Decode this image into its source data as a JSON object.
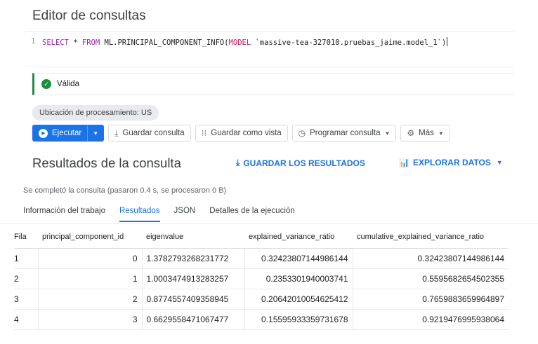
{
  "editor": {
    "title": "Editor de consultas",
    "line_number": "1",
    "code": {
      "kw1": "SELECT",
      "star": " * ",
      "kw2": "FROM",
      "fn": " ML.PRINCIPAL_COMPONENT_INFO",
      "open": "(",
      "kw3": "MODEL",
      "str": " `massive-tea-327010.pruebas_jaime.model_1`",
      "close": ")"
    }
  },
  "validation": {
    "status": "Válida",
    "color": "#1e8e3e"
  },
  "location_chip": "Ubicación de procesamiento: US",
  "toolbar": {
    "run": "Ejecutar",
    "save_query": "Guardar consulta",
    "save_view": "Guardar como vista",
    "schedule": "Programar consulta",
    "more": "Más"
  },
  "results": {
    "title": "Resultados de la consulta",
    "save_results": "GUARDAR LOS RESULTADOS",
    "explore_data": "EXPLORAR DATOS",
    "status": "Se completó la consulta (pasaron 0.4 s, se procesaron 0 B)",
    "tabs": [
      "Información del trabajo",
      "Resultados",
      "JSON",
      "Detalles de la ejecución"
    ],
    "active_tab": "Resultados",
    "columns": [
      "Fila",
      "principal_component_id",
      "eigenvalue",
      "explained_variance_ratio",
      "cumulative_explained_variance_ratio"
    ],
    "rows": [
      [
        "1",
        "0",
        "1.3782793268231772",
        "0.32423807144986144",
        "0.32423807144986144"
      ],
      [
        "2",
        "1",
        "1.0003474913283257",
        "0.2353301940003741",
        "0.5595682654502355"
      ],
      [
        "3",
        "2",
        "0.8774557409358945",
        "0.20642010054625412",
        "0.7659883659964897"
      ],
      [
        "4",
        "3",
        "0.6629558471067477",
        "0.15595933359731678",
        "0.9219476995938064"
      ]
    ]
  },
  "accent_color": "#1a73e8"
}
